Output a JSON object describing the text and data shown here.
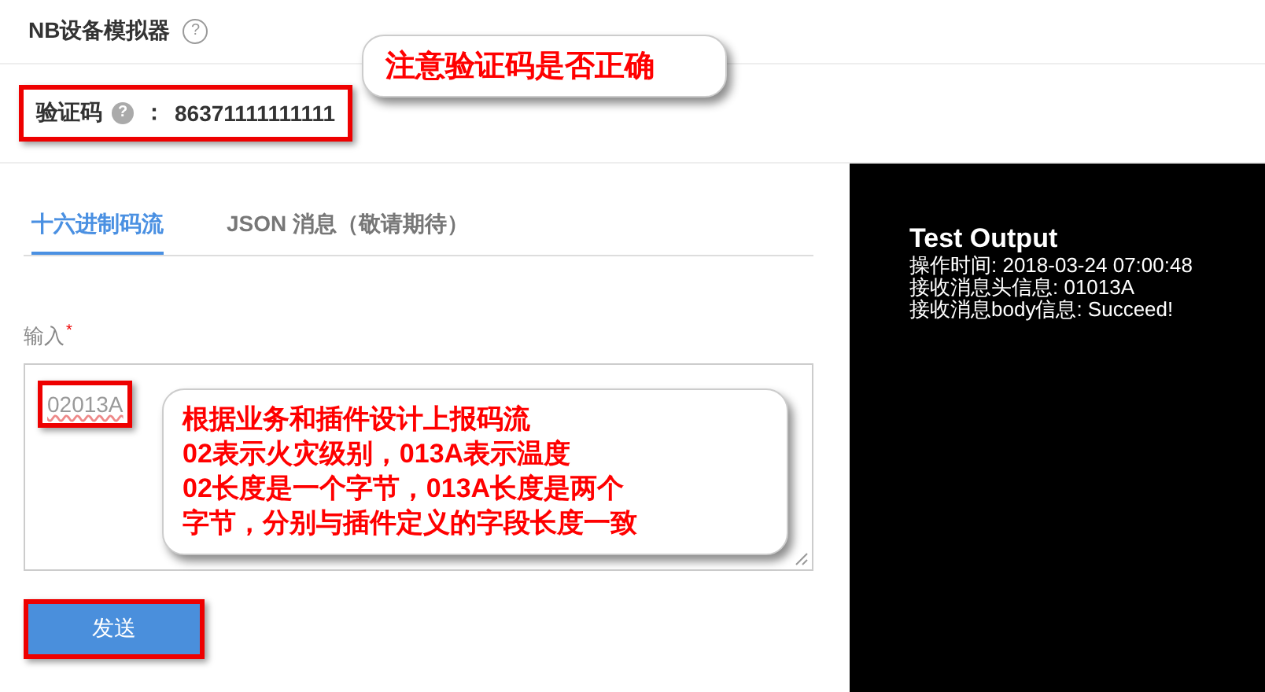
{
  "header": {
    "title": "NB设备模拟器",
    "help": "?"
  },
  "captcha": {
    "label": "验证码",
    "help": "?",
    "separator": "：",
    "value": "86371111111111",
    "highlighted": true
  },
  "tabs": [
    {
      "label": "十六进制码流",
      "selected": true
    },
    {
      "label": "JSON 消息（敬请期待）",
      "selected": false
    }
  ],
  "input": {
    "label": "输入",
    "required_mark": "*",
    "value": "02013A",
    "highlighted": true
  },
  "send_button": {
    "label": "发送",
    "highlighted": true
  },
  "output": {
    "title": "Test Output",
    "lines": [
      "操作时间: 2018-03-24 07:00:48",
      "接收消息头信息: 01013A",
      "接收消息body信息: Succeed!"
    ]
  },
  "callouts": [
    {
      "kind": "top",
      "lines": [
        "注意验证码是否正确"
      ]
    },
    {
      "kind": "input",
      "lines": [
        "根据业务和插件设计上报码流",
        "02表示火灾级别，013A表示温度",
        "02长度是一个字节，013A长度是两个",
        "字节，分别与插件定义的字段长度一致"
      ]
    }
  ]
}
